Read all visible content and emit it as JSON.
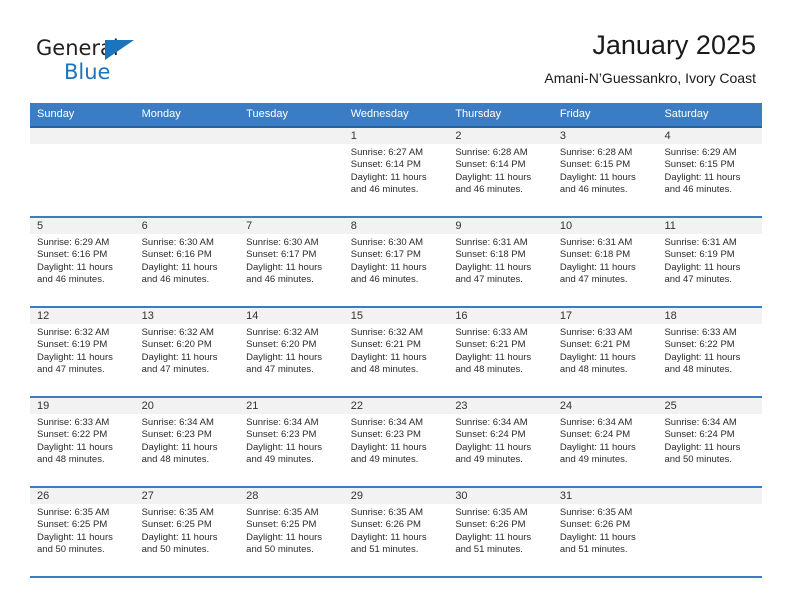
{
  "brand": {
    "name_top": "General",
    "name_bottom": "Blue",
    "triangle_icon": "triangle-icon",
    "accent_color": "#1b74bc"
  },
  "header": {
    "title": "January 2025",
    "subtitle": "Amani-N’Guessankro, Ivory Coast"
  },
  "theme": {
    "header_row_bg": "#3b7dc4",
    "day_band_bg": "#f2f2f2",
    "cell_bg": "#ffffff",
    "text_color": "#2b2b2b"
  },
  "weekdays": [
    "Sunday",
    "Monday",
    "Tuesday",
    "Wednesday",
    "Thursday",
    "Friday",
    "Saturday"
  ],
  "weeks": [
    [
      {
        "day": "",
        "sunrise": "",
        "sunset": "",
        "daylight_line1": "",
        "daylight_line2": ""
      },
      {
        "day": "",
        "sunrise": "",
        "sunset": "",
        "daylight_line1": "",
        "daylight_line2": ""
      },
      {
        "day": "",
        "sunrise": "",
        "sunset": "",
        "daylight_line1": "",
        "daylight_line2": ""
      },
      {
        "day": "1",
        "sunrise": "Sunrise: 6:27 AM",
        "sunset": "Sunset: 6:14 PM",
        "daylight_line1": "Daylight: 11 hours",
        "daylight_line2": "and 46 minutes."
      },
      {
        "day": "2",
        "sunrise": "Sunrise: 6:28 AM",
        "sunset": "Sunset: 6:14 PM",
        "daylight_line1": "Daylight: 11 hours",
        "daylight_line2": "and 46 minutes."
      },
      {
        "day": "3",
        "sunrise": "Sunrise: 6:28 AM",
        "sunset": "Sunset: 6:15 PM",
        "daylight_line1": "Daylight: 11 hours",
        "daylight_line2": "and 46 minutes."
      },
      {
        "day": "4",
        "sunrise": "Sunrise: 6:29 AM",
        "sunset": "Sunset: 6:15 PM",
        "daylight_line1": "Daylight: 11 hours",
        "daylight_line2": "and 46 minutes."
      }
    ],
    [
      {
        "day": "5",
        "sunrise": "Sunrise: 6:29 AM",
        "sunset": "Sunset: 6:16 PM",
        "daylight_line1": "Daylight: 11 hours",
        "daylight_line2": "and 46 minutes."
      },
      {
        "day": "6",
        "sunrise": "Sunrise: 6:30 AM",
        "sunset": "Sunset: 6:16 PM",
        "daylight_line1": "Daylight: 11 hours",
        "daylight_line2": "and 46 minutes."
      },
      {
        "day": "7",
        "sunrise": "Sunrise: 6:30 AM",
        "sunset": "Sunset: 6:17 PM",
        "daylight_line1": "Daylight: 11 hours",
        "daylight_line2": "and 46 minutes."
      },
      {
        "day": "8",
        "sunrise": "Sunrise: 6:30 AM",
        "sunset": "Sunset: 6:17 PM",
        "daylight_line1": "Daylight: 11 hours",
        "daylight_line2": "and 46 minutes."
      },
      {
        "day": "9",
        "sunrise": "Sunrise: 6:31 AM",
        "sunset": "Sunset: 6:18 PM",
        "daylight_line1": "Daylight: 11 hours",
        "daylight_line2": "and 47 minutes."
      },
      {
        "day": "10",
        "sunrise": "Sunrise: 6:31 AM",
        "sunset": "Sunset: 6:18 PM",
        "daylight_line1": "Daylight: 11 hours",
        "daylight_line2": "and 47 minutes."
      },
      {
        "day": "11",
        "sunrise": "Sunrise: 6:31 AM",
        "sunset": "Sunset: 6:19 PM",
        "daylight_line1": "Daylight: 11 hours",
        "daylight_line2": "and 47 minutes."
      }
    ],
    [
      {
        "day": "12",
        "sunrise": "Sunrise: 6:32 AM",
        "sunset": "Sunset: 6:19 PM",
        "daylight_line1": "Daylight: 11 hours",
        "daylight_line2": "and 47 minutes."
      },
      {
        "day": "13",
        "sunrise": "Sunrise: 6:32 AM",
        "sunset": "Sunset: 6:20 PM",
        "daylight_line1": "Daylight: 11 hours",
        "daylight_line2": "and 47 minutes."
      },
      {
        "day": "14",
        "sunrise": "Sunrise: 6:32 AM",
        "sunset": "Sunset: 6:20 PM",
        "daylight_line1": "Daylight: 11 hours",
        "daylight_line2": "and 47 minutes."
      },
      {
        "day": "15",
        "sunrise": "Sunrise: 6:32 AM",
        "sunset": "Sunset: 6:21 PM",
        "daylight_line1": "Daylight: 11 hours",
        "daylight_line2": "and 48 minutes."
      },
      {
        "day": "16",
        "sunrise": "Sunrise: 6:33 AM",
        "sunset": "Sunset: 6:21 PM",
        "daylight_line1": "Daylight: 11 hours",
        "daylight_line2": "and 48 minutes."
      },
      {
        "day": "17",
        "sunrise": "Sunrise: 6:33 AM",
        "sunset": "Sunset: 6:21 PM",
        "daylight_line1": "Daylight: 11 hours",
        "daylight_line2": "and 48 minutes."
      },
      {
        "day": "18",
        "sunrise": "Sunrise: 6:33 AM",
        "sunset": "Sunset: 6:22 PM",
        "daylight_line1": "Daylight: 11 hours",
        "daylight_line2": "and 48 minutes."
      }
    ],
    [
      {
        "day": "19",
        "sunrise": "Sunrise: 6:33 AM",
        "sunset": "Sunset: 6:22 PM",
        "daylight_line1": "Daylight: 11 hours",
        "daylight_line2": "and 48 minutes."
      },
      {
        "day": "20",
        "sunrise": "Sunrise: 6:34 AM",
        "sunset": "Sunset: 6:23 PM",
        "daylight_line1": "Daylight: 11 hours",
        "daylight_line2": "and 48 minutes."
      },
      {
        "day": "21",
        "sunrise": "Sunrise: 6:34 AM",
        "sunset": "Sunset: 6:23 PM",
        "daylight_line1": "Daylight: 11 hours",
        "daylight_line2": "and 49 minutes."
      },
      {
        "day": "22",
        "sunrise": "Sunrise: 6:34 AM",
        "sunset": "Sunset: 6:23 PM",
        "daylight_line1": "Daylight: 11 hours",
        "daylight_line2": "and 49 minutes."
      },
      {
        "day": "23",
        "sunrise": "Sunrise: 6:34 AM",
        "sunset": "Sunset: 6:24 PM",
        "daylight_line1": "Daylight: 11 hours",
        "daylight_line2": "and 49 minutes."
      },
      {
        "day": "24",
        "sunrise": "Sunrise: 6:34 AM",
        "sunset": "Sunset: 6:24 PM",
        "daylight_line1": "Daylight: 11 hours",
        "daylight_line2": "and 49 minutes."
      },
      {
        "day": "25",
        "sunrise": "Sunrise: 6:34 AM",
        "sunset": "Sunset: 6:24 PM",
        "daylight_line1": "Daylight: 11 hours",
        "daylight_line2": "and 50 minutes."
      }
    ],
    [
      {
        "day": "26",
        "sunrise": "Sunrise: 6:35 AM",
        "sunset": "Sunset: 6:25 PM",
        "daylight_line1": "Daylight: 11 hours",
        "daylight_line2": "and 50 minutes."
      },
      {
        "day": "27",
        "sunrise": "Sunrise: 6:35 AM",
        "sunset": "Sunset: 6:25 PM",
        "daylight_line1": "Daylight: 11 hours",
        "daylight_line2": "and 50 minutes."
      },
      {
        "day": "28",
        "sunrise": "Sunrise: 6:35 AM",
        "sunset": "Sunset: 6:25 PM",
        "daylight_line1": "Daylight: 11 hours",
        "daylight_line2": "and 50 minutes."
      },
      {
        "day": "29",
        "sunrise": "Sunrise: 6:35 AM",
        "sunset": "Sunset: 6:26 PM",
        "daylight_line1": "Daylight: 11 hours",
        "daylight_line2": "and 51 minutes."
      },
      {
        "day": "30",
        "sunrise": "Sunrise: 6:35 AM",
        "sunset": "Sunset: 6:26 PM",
        "daylight_line1": "Daylight: 11 hours",
        "daylight_line2": "and 51 minutes."
      },
      {
        "day": "31",
        "sunrise": "Sunrise: 6:35 AM",
        "sunset": "Sunset: 6:26 PM",
        "daylight_line1": "Daylight: 11 hours",
        "daylight_line2": "and 51 minutes."
      },
      {
        "day": "",
        "sunrise": "",
        "sunset": "",
        "daylight_line1": "",
        "daylight_line2": ""
      }
    ]
  ]
}
